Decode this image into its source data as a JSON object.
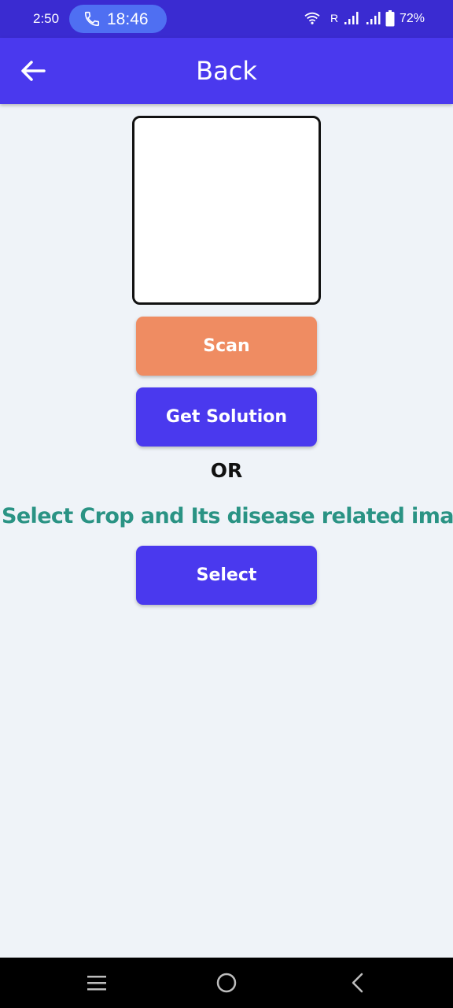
{
  "status_bar": {
    "time": "2:50",
    "call_time": "18:46",
    "roaming": "R",
    "battery": "72%",
    "icons": [
      "phone-icon",
      "wifi-icon",
      "signal-icon",
      "battery-icon"
    ]
  },
  "app_bar": {
    "title": "Back",
    "back_icon": "arrow-left-icon"
  },
  "main": {
    "scan_label": "Scan",
    "solution_label": "Get Solution",
    "or_label": "OR",
    "instruction": "Select Crop and Its disease related image",
    "select_label": "Select"
  },
  "nav_bar": {
    "icons": [
      "recent-apps-icon",
      "home-icon",
      "back-icon"
    ]
  },
  "colors": {
    "status_bar": "#3a2bd1",
    "app_bar": "#4a39ee",
    "primary_button": "#4a39ee",
    "scan_button": "#ef8c62",
    "instruction_text": "#2a9384",
    "background": "#eff3f8"
  }
}
